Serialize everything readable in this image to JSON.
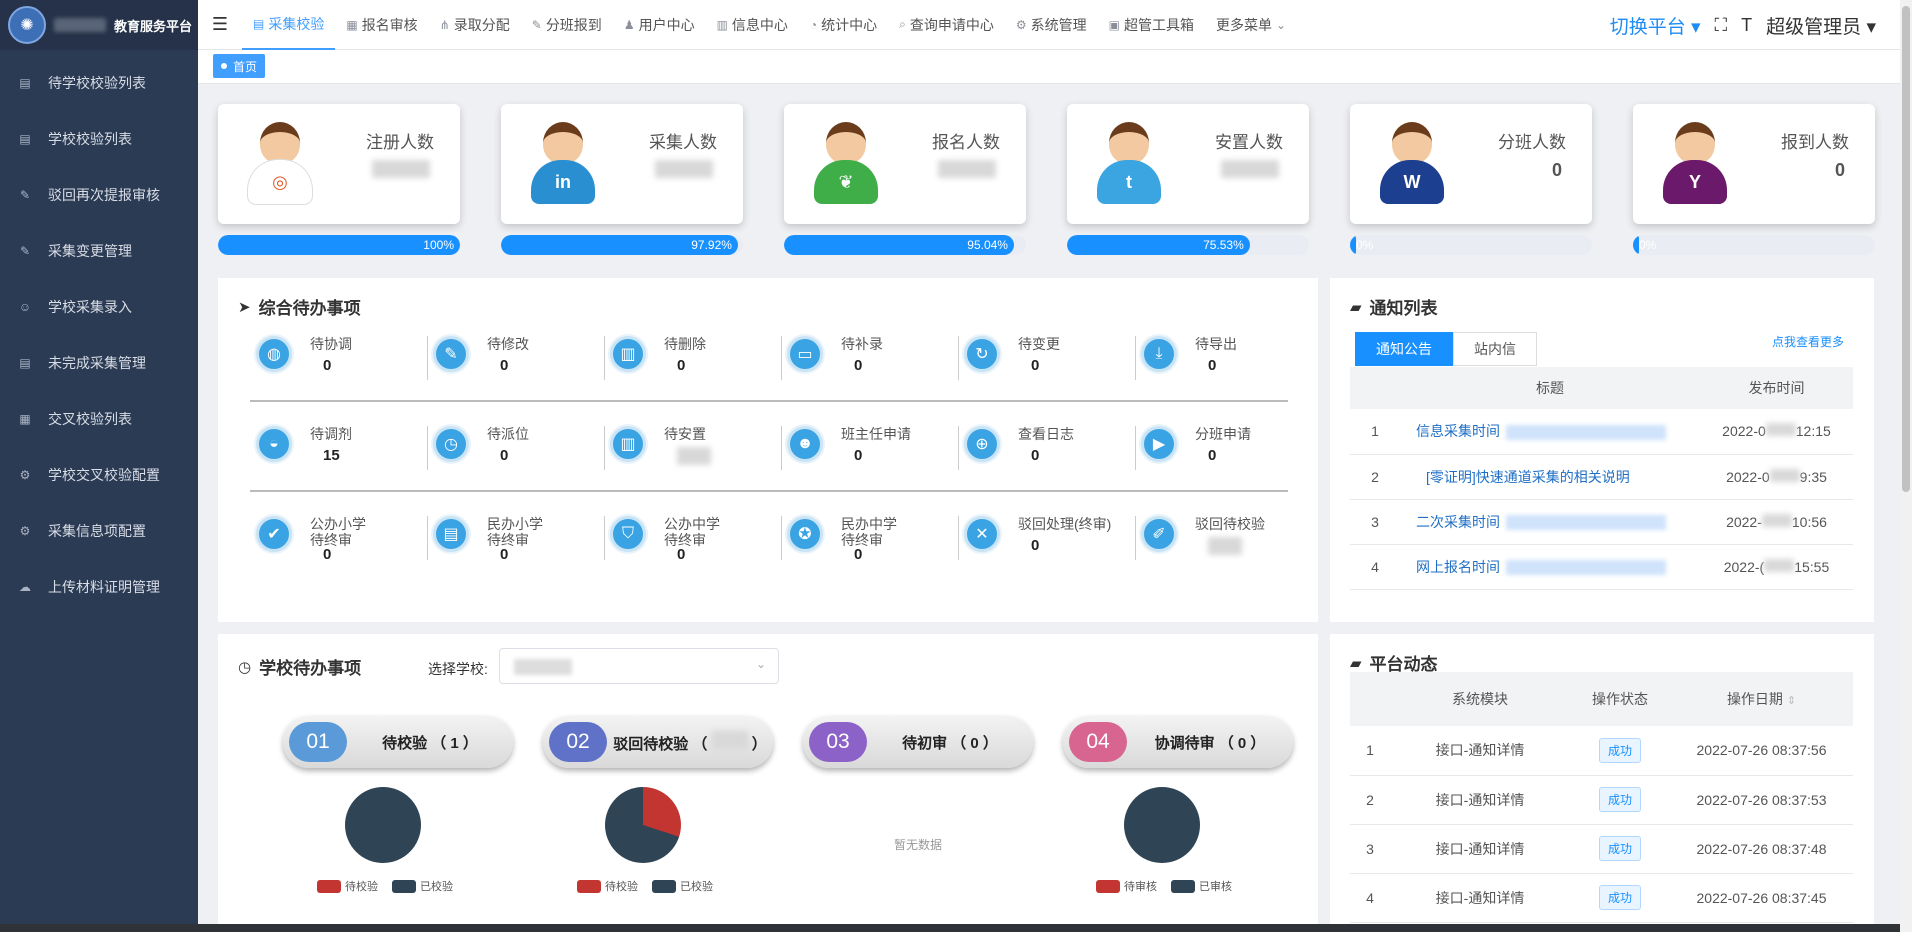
{
  "app": {
    "title": "教育服务平台"
  },
  "sidebar": {
    "items": [
      {
        "label": "待学校校验列表",
        "icon": "list-icon"
      },
      {
        "label": "学校校验列表",
        "icon": "list-icon"
      },
      {
        "label": "驳回再次提报审核",
        "icon": "edit-icon"
      },
      {
        "label": "采集变更管理",
        "icon": "edit-icon"
      },
      {
        "label": "学校采集录入",
        "icon": "user-icon"
      },
      {
        "label": "未完成采集管理",
        "icon": "list-icon"
      },
      {
        "label": "交叉校验列表",
        "icon": "doc-icon"
      },
      {
        "label": "学校交叉校验配置",
        "icon": "gear-icon"
      },
      {
        "label": "采集信息项配置",
        "icon": "gear-icon"
      },
      {
        "label": "上传材料证明管理",
        "icon": "cloud-icon"
      }
    ]
  },
  "topnav": {
    "tabs": [
      {
        "label": "采集校验",
        "icon": "list-icon"
      },
      {
        "label": "报名审核",
        "icon": "doc-icon"
      },
      {
        "label": "录取分配",
        "icon": "sitemap-icon"
      },
      {
        "label": "分班报到",
        "icon": "edit-icon"
      },
      {
        "label": "用户中心",
        "icon": "users-icon"
      },
      {
        "label": "信息中心",
        "icon": "file-icon"
      },
      {
        "label": "统计中心",
        "icon": "dashboard-icon"
      },
      {
        "label": "查询申请中心",
        "icon": "search-icon"
      },
      {
        "label": "系统管理",
        "icon": "gear-icon"
      },
      {
        "label": "超管工具箱",
        "icon": "toolbox-icon"
      },
      {
        "label": "更多菜单",
        "icon": "chevron-down-icon"
      }
    ],
    "switch_label": "切换平台",
    "admin_label": "超级管理员"
  },
  "breadcrumb": {
    "home": "首页"
  },
  "stats": [
    {
      "label": "注册人数",
      "value": "",
      "progress": "100%",
      "pct": 100,
      "color": "#ffffff",
      "badge": "◎"
    },
    {
      "label": "采集人数",
      "value": "",
      "progress": "97.92%",
      "pct": 97.92,
      "color": "#2a8fd1",
      "badge": "in"
    },
    {
      "label": "报名人数",
      "value": "",
      "progress": "95.04%",
      "pct": 95.04,
      "color": "#3fae49",
      "badge": "❦"
    },
    {
      "label": "安置人数",
      "value": "",
      "progress": "75.53%",
      "pct": 75.53,
      "color": "#3aa5e0",
      "badge": "t"
    },
    {
      "label": "分班人数",
      "value": "0",
      "progress": "0%",
      "pct": 0,
      "color": "#1d3f8f",
      "badge": "W"
    },
    {
      "label": "报到人数",
      "value": "0",
      "progress": "0%",
      "pct": 0,
      "color": "#6b1a6b",
      "badge": "Y"
    }
  ],
  "todo": {
    "title": "综合待办事项",
    "rows": [
      [
        {
          "label": "待协调",
          "value": "0",
          "icon": "globe-icon"
        },
        {
          "label": "待修改",
          "value": "0",
          "icon": "pencil-icon"
        },
        {
          "label": "待删除",
          "value": "0",
          "icon": "trash-icon"
        },
        {
          "label": "待补录",
          "value": "0",
          "icon": "monitor-icon"
        },
        {
          "label": "待变更",
          "value": "0",
          "icon": "refresh-icon"
        },
        {
          "label": "待导出",
          "value": "0",
          "icon": "download-icon"
        }
      ],
      [
        {
          "label": "待调剂",
          "value": "15",
          "icon": "basket-icon"
        },
        {
          "label": "待派位",
          "value": "0",
          "icon": "clock-icon"
        },
        {
          "label": "待安置",
          "value": "",
          "icon": "chart-icon"
        },
        {
          "label": "班主任申请",
          "value": "0",
          "icon": "person-icon"
        },
        {
          "label": "查看日志",
          "value": "0",
          "icon": "zoom-icon"
        },
        {
          "label": "分班申请",
          "value": "0",
          "icon": "play-icon"
        }
      ],
      [
        {
          "label": "公办小学\n待终审",
          "value": "0",
          "icon": "check-icon"
        },
        {
          "label": "民办小学\n待终审",
          "value": "0",
          "icon": "folder-icon"
        },
        {
          "label": "公办中学\n待终审",
          "value": "0",
          "icon": "shield-icon"
        },
        {
          "label": "民办中学\n待终审",
          "value": "0",
          "icon": "award-icon"
        },
        {
          "label": "驳回处理(终审)",
          "value": "0",
          "icon": "x-icon"
        },
        {
          "label": "驳回待校验",
          "value": "",
          "icon": "pen-icon"
        }
      ]
    ]
  },
  "notices": {
    "title": "通知列表",
    "tabs": [
      "通知公告",
      "站内信"
    ],
    "more": "点我查看更多",
    "columns": [
      "标题",
      "发布时间"
    ],
    "rows": [
      {
        "no": "1",
        "title": "信息采集时间",
        "date": "2022-0",
        "time": "12:15"
      },
      {
        "no": "2",
        "title": "[零证明]快速通道采集的相关说明",
        "date": "2022-0",
        "time": "9:35"
      },
      {
        "no": "3",
        "title": "二次采集时间",
        "date": "2022-",
        "time": "10:56"
      },
      {
        "no": "4",
        "title": "网上报名时间",
        "date": "2022-(",
        "time": "15:55"
      }
    ]
  },
  "school": {
    "title": "学校待办事项",
    "select_label": "选择学校:",
    "no_data": "暂无数据",
    "pills": [
      {
        "num": "01",
        "label": "待校验",
        "count": "1",
        "color": "#5b9ad8"
      },
      {
        "num": "02",
        "label": "驳回待校验",
        "count": "",
        "color": "#6072c8"
      },
      {
        "num": "03",
        "label": "待初审",
        "count": "0",
        "color": "#8c62c8"
      },
      {
        "num": "04",
        "label": "协调待审",
        "count": "0",
        "color": "#d8658f"
      }
    ],
    "charts": [
      {
        "legend": [
          "待校验",
          "已校验"
        ],
        "values": [
          0,
          1
        ]
      },
      {
        "legend": [
          "待校验",
          "已校验"
        ],
        "values": [
          0.3,
          0.7
        ]
      },
      {
        "legend": [
          "待审核",
          "已审核"
        ],
        "values": [
          0,
          1
        ]
      }
    ],
    "series_colors": [
      "#c23531",
      "#2f4455"
    ]
  },
  "activity": {
    "title": "平台动态",
    "columns": [
      "系统模块",
      "操作状态",
      "操作日期"
    ],
    "rows": [
      {
        "no": "1",
        "module": "接口-通知详情",
        "status": "成功",
        "date": "2022-07-26 08:37:56"
      },
      {
        "no": "2",
        "module": "接口-通知详情",
        "status": "成功",
        "date": "2022-07-26 08:37:53"
      },
      {
        "no": "3",
        "module": "接口-通知详情",
        "status": "成功",
        "date": "2022-07-26 08:37:48"
      },
      {
        "no": "4",
        "module": "接口-通知详情",
        "status": "成功",
        "date": "2022-07-26 08:37:45"
      }
    ]
  }
}
